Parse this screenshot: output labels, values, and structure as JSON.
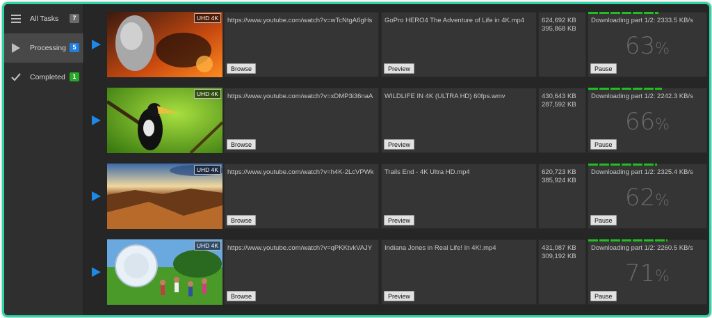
{
  "sidebar": {
    "items": [
      {
        "label": "All Tasks",
        "count": "7",
        "badge_color": "#6b6b6b",
        "icon": "menu-icon"
      },
      {
        "label": "Processing",
        "count": "5",
        "badge_color": "#1e7fe0",
        "icon": "play-icon"
      },
      {
        "label": "Completed",
        "count": "1",
        "badge_color": "#2aa82a",
        "icon": "check-icon"
      }
    ]
  },
  "colors": {
    "accent": "#2bd6a6",
    "play": "#1e88e5",
    "progress": "#1fbf1f"
  },
  "tasks": [
    {
      "quality": "UHD 4K",
      "url": "https://www.youtube.com/watch?v=wTcNtgA6gHs",
      "filename": "GoPro HERO4  The Adventure of Life in 4K.mp4",
      "total_size": "624,692 KB",
      "downloaded_size": "395,868 KB",
      "status": "Downloading part 1/2: 2333.5 KB/s",
      "percent": "63",
      "progress": 0.63,
      "browse_label": "Browse",
      "preview_label": "Preview",
      "pause_label": "Pause"
    },
    {
      "quality": "UHD 4K",
      "url": "https://www.youtube.com/watch?v=xDMP3i36naA",
      "filename": "WILDLIFE IN 4K (ULTRA HD) 60fps.wmv",
      "total_size": "430,643 KB",
      "downloaded_size": "287,592 KB",
      "status": "Downloading part 1/2: 2242.3 KB/s",
      "percent": "66",
      "progress": 0.66,
      "browse_label": "Browse",
      "preview_label": "Preview",
      "pause_label": "Pause"
    },
    {
      "quality": "UHD 4K",
      "url": "https://www.youtube.com/watch?v=h4K-2LcVPWk",
      "filename": "Trails End - 4K Ultra HD.mp4",
      "total_size": "620,723 KB",
      "downloaded_size": "385,924 KB",
      "status": "Downloading part 1/2: 2325.4 KB/s",
      "percent": "62",
      "progress": 0.62,
      "browse_label": "Browse",
      "preview_label": "Preview",
      "pause_label": "Pause"
    },
    {
      "quality": "UHD 4K",
      "url": "https://www.youtube.com/watch?v=qPKKtvkVAJY",
      "filename": "Indiana Jones in Real Life! In 4K!.mp4",
      "total_size": "431,087 KB",
      "downloaded_size": "309,192 KB",
      "status": "Downloading part 1/2: 2260.5 KB/s",
      "percent": "71",
      "progress": 0.71,
      "browse_label": "Browse",
      "preview_label": "Preview",
      "pause_label": "Pause"
    }
  ]
}
